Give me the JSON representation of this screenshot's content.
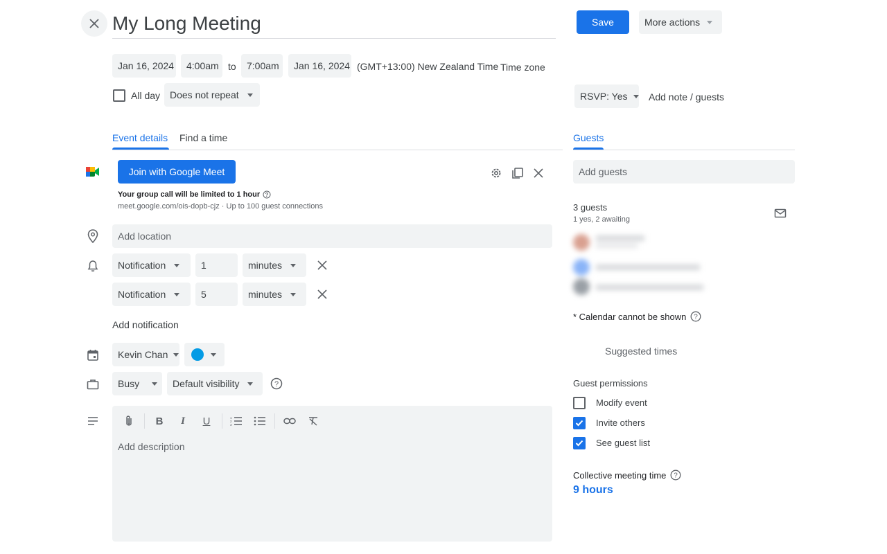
{
  "header": {
    "title": "My Long Meeting",
    "save_label": "Save",
    "more_actions_label": "More actions"
  },
  "datetime": {
    "start_date": "Jan 16, 2024",
    "start_time": "4:00am",
    "to_label": "to",
    "end_time": "7:00am",
    "end_date": "Jan 16, 2024",
    "timezone_name": "(GMT+13:00) New Zealand Time",
    "timezone_link": "Time zone",
    "all_day_label": "All day",
    "repeat_label": "Does not repeat"
  },
  "rsvp": {
    "label": "RSVP: Yes",
    "add_note_label": "Add note / guests"
  },
  "tabs": {
    "event_details": "Event details",
    "find_time": "Find a time",
    "guests": "Guests"
  },
  "meet": {
    "join_label": "Join with Google Meet",
    "limit_text": "Your group call will be limited to 1 hour",
    "link_text": "meet.google.com/ois-dopb-cjz · Up to 100 guest connections"
  },
  "location": {
    "placeholder": "Add location"
  },
  "notifications": {
    "items": [
      {
        "type": "Notification",
        "value": "1",
        "unit": "minutes"
      },
      {
        "type": "Notification",
        "value": "5",
        "unit": "minutes"
      }
    ],
    "add_label": "Add notification"
  },
  "calendar": {
    "owner": "Kevin Chan",
    "color": "#039be5"
  },
  "availability": {
    "status": "Busy",
    "visibility": "Default visibility"
  },
  "description": {
    "placeholder": "Add description"
  },
  "guests": {
    "placeholder": "Add guests",
    "count_label": "3 guests",
    "summary": "1 yes, 2 awaiting",
    "calendar_note": "* Calendar cannot be shown",
    "suggested_times": "Suggested times",
    "permissions_title": "Guest permissions",
    "permissions": [
      {
        "label": "Modify event",
        "checked": false
      },
      {
        "label": "Invite others",
        "checked": true
      },
      {
        "label": "See guest list",
        "checked": true
      }
    ],
    "collective_label": "Collective meeting time",
    "collective_value": "9 hours"
  },
  "colors": {
    "accent": "#1a73e8",
    "chip_bg": "#f1f3f4",
    "text": "#3c4043",
    "muted": "#5f6368"
  }
}
